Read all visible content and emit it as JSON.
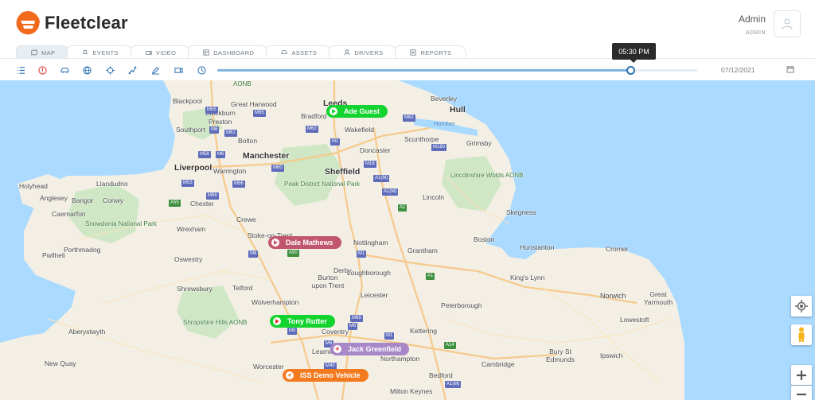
{
  "app": {
    "name": "Fleetclear"
  },
  "user": {
    "name": "Admin",
    "role": "ADMIN"
  },
  "tabs": [
    {
      "label": "MAP",
      "icon": "map-icon",
      "active": true
    },
    {
      "label": "EVENTS",
      "icon": "bell-icon"
    },
    {
      "label": "VIDEO",
      "icon": "video-icon"
    },
    {
      "label": "DASHBOARD",
      "icon": "dashboard-icon"
    },
    {
      "label": "ASSETS",
      "icon": "car-icon"
    },
    {
      "label": "DRIVERS",
      "icon": "person-icon"
    },
    {
      "label": "REPORTS",
      "icon": "report-icon"
    }
  ],
  "toolbar": {
    "time": "05:30 PM",
    "date": "07/12/2021",
    "progress": 0.86
  },
  "map": {
    "places": [
      {
        "name": "Blackpool",
        "type": "city"
      },
      {
        "name": "Great Harwood",
        "type": "town"
      },
      {
        "name": "Leeds",
        "type": "city"
      },
      {
        "name": "Beverley",
        "type": "town"
      },
      {
        "name": "Hull",
        "type": "city"
      },
      {
        "name": "Blackburn",
        "type": "town"
      },
      {
        "name": "Bradford",
        "type": "town"
      },
      {
        "name": "Preston",
        "type": "town"
      },
      {
        "name": "Southport",
        "type": "town"
      },
      {
        "name": "Bolton",
        "type": "town"
      },
      {
        "name": "Wakefield",
        "type": "town"
      },
      {
        "name": "Scunthorpe",
        "type": "town"
      },
      {
        "name": "Grimsby",
        "type": "town"
      },
      {
        "name": "Doncaster",
        "type": "town"
      },
      {
        "name": "Manchester",
        "type": "major"
      },
      {
        "name": "Liverpool",
        "type": "major"
      },
      {
        "name": "Warrington",
        "type": "town"
      },
      {
        "name": "Sheffield",
        "type": "major"
      },
      {
        "name": "Holyhead",
        "type": "town"
      },
      {
        "name": "Llandudno",
        "type": "town"
      },
      {
        "name": "Anglesey",
        "type": "town"
      },
      {
        "name": "Bangor",
        "type": "town"
      },
      {
        "name": "Conwy",
        "type": "town"
      },
      {
        "name": "Caernarfon",
        "type": "town"
      },
      {
        "name": "Chester",
        "type": "town"
      },
      {
        "name": "Crewe",
        "type": "town"
      },
      {
        "name": "Wrexham",
        "type": "town"
      },
      {
        "name": "Stoke-on-Trent",
        "type": "town"
      },
      {
        "name": "Lincoln",
        "type": "city"
      },
      {
        "name": "Skegness",
        "type": "town"
      },
      {
        "name": "Nottingham",
        "type": "city"
      },
      {
        "name": "Derby",
        "type": "city"
      },
      {
        "name": "Grantham",
        "type": "town"
      },
      {
        "name": "Boston",
        "type": "town"
      },
      {
        "name": "Hunstanton",
        "type": "town"
      },
      {
        "name": "Cromer",
        "type": "town"
      },
      {
        "name": "Pwllheli",
        "type": "town"
      },
      {
        "name": "Porthmadog",
        "type": "town"
      },
      {
        "name": "Oswestry",
        "type": "town"
      },
      {
        "name": "Shrewsbury",
        "type": "town"
      },
      {
        "name": "Telford",
        "type": "town"
      },
      {
        "name": "Burton upon Trent",
        "type": "town"
      },
      {
        "name": "Loughborough",
        "type": "town"
      },
      {
        "name": "King's Lynn",
        "type": "town"
      },
      {
        "name": "Leicester",
        "type": "city"
      },
      {
        "name": "Peterborough",
        "type": "city"
      },
      {
        "name": "Norwich",
        "type": "city"
      },
      {
        "name": "Great Yarmouth",
        "type": "town"
      },
      {
        "name": "Wolverhampton",
        "type": "city"
      },
      {
        "name": "Aberystwyth",
        "type": "town"
      },
      {
        "name": "Coventry",
        "type": "city"
      },
      {
        "name": "Kettering",
        "type": "town"
      },
      {
        "name": "Lowestoft",
        "type": "town"
      },
      {
        "name": "Leamington",
        "type": "town"
      },
      {
        "name": "Northampton",
        "type": "town"
      },
      {
        "name": "Bury St Edmunds",
        "type": "town"
      },
      {
        "name": "Ipswich",
        "type": "town"
      },
      {
        "name": "New Quay",
        "type": "town"
      },
      {
        "name": "Worcester",
        "type": "city"
      },
      {
        "name": "Cambridge",
        "type": "city"
      },
      {
        "name": "Bedford",
        "type": "town"
      },
      {
        "name": "Milton Keynes",
        "type": "town"
      },
      {
        "name": "Lincolnshire Wolds AONB",
        "type": "park"
      },
      {
        "name": "Peak District National Park",
        "type": "park"
      },
      {
        "name": "Snowdonia National Park",
        "type": "park"
      },
      {
        "name": "Shropshire Hills AONB",
        "type": "park"
      },
      {
        "name": "AONB",
        "type": "park"
      },
      {
        "name": "Humber",
        "type": "water"
      }
    ],
    "roads": [
      "M55",
      "M65",
      "M6",
      "M62",
      "M62",
      "M61",
      "M1",
      "M180",
      "M58",
      "M6",
      "M60",
      "M18",
      "A1(M)",
      "M53",
      "M56",
      "M56",
      "A55",
      "M6",
      "A1(M)",
      "A1",
      "M1",
      "A50",
      "M1",
      "A1",
      "M69",
      "M6",
      "M5",
      "M1",
      "A14",
      "M40",
      "M6",
      "A1(M)"
    ]
  },
  "vehicles": [
    {
      "label": "Ade Guest",
      "color": "#13d32e",
      "icon": "play-icon"
    },
    {
      "label": "Dale Mathews",
      "color": "#c1576f",
      "icon": "play-icon"
    },
    {
      "label": "Tony Rutter",
      "color": "#13d32e",
      "icon": "play-icon"
    },
    {
      "label": "Jack Greenfield",
      "color": "#a887c8",
      "icon": "navigation-icon"
    },
    {
      "label": "ISS Demo Vehicle",
      "color": "#f47a1f",
      "icon": "navigation-icon"
    }
  ],
  "map_controls": [
    "locate-icon",
    "pegman-icon",
    "zoom-in-icon",
    "zoom-out-icon"
  ]
}
